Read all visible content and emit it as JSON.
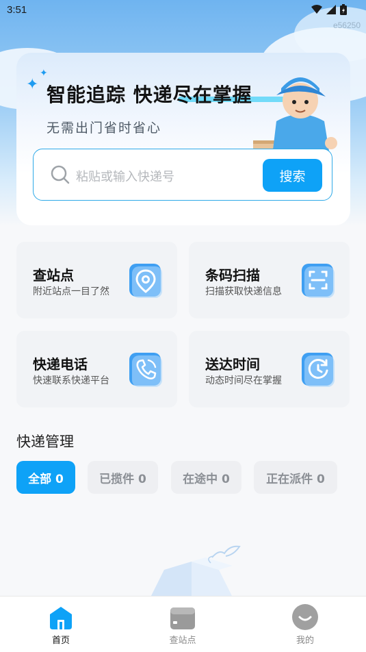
{
  "status_bar": {
    "time": "3:51",
    "build_tag": "e56250"
  },
  "hero": {
    "title": "智能追踪 快递尽在掌握",
    "subtitle": "无需出门省时省心"
  },
  "search": {
    "placeholder": "粘贴或输入快递号",
    "button_label": "搜索"
  },
  "services": [
    {
      "title": "查站点",
      "subtitle": "附近站点一目了然",
      "icon": "location-pin-icon"
    },
    {
      "title": "条码扫描",
      "subtitle": "扫描获取快递信息",
      "icon": "scan-icon"
    },
    {
      "title": "快递电话",
      "subtitle": "快速联系快递平台",
      "icon": "phone-icon"
    },
    {
      "title": "送达时间",
      "subtitle": "动态时间尽在掌握",
      "icon": "clock-icon"
    }
  ],
  "management": {
    "title": "快递管理",
    "filters": [
      {
        "label": "全部 0",
        "active": true
      },
      {
        "label": "已揽件 0",
        "active": false
      },
      {
        "label": "在途中 0",
        "active": false
      },
      {
        "label": "正在派件 0",
        "active": false
      }
    ]
  },
  "tabbar": [
    {
      "label": "首页",
      "icon": "home-icon",
      "active": true
    },
    {
      "label": "查站点",
      "icon": "station-icon",
      "active": false
    },
    {
      "label": "我的",
      "icon": "profile-icon",
      "active": false
    }
  ],
  "colors": {
    "accent": "#0ea2f7",
    "sky": "#6fb4f0"
  }
}
